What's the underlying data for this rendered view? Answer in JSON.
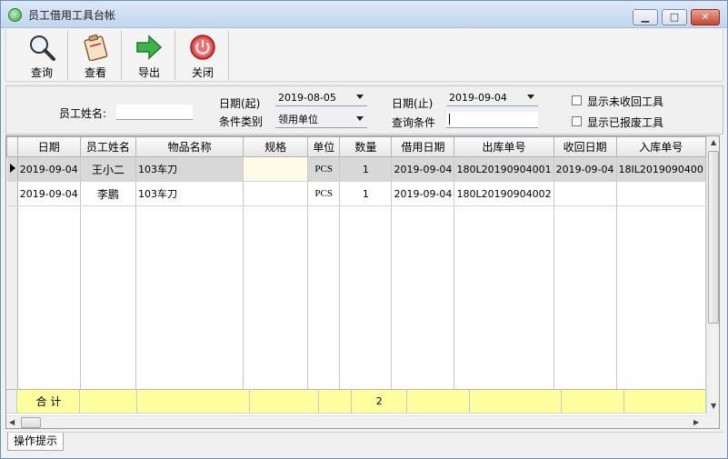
{
  "window": {
    "title": "员工借用工具台帐"
  },
  "toolbar": {
    "query": "查询",
    "view": "查看",
    "export": "导出",
    "close": "关闭"
  },
  "filter": {
    "employee_label": "员工姓名:",
    "employee_value": "",
    "date_start_label": "日期(起)",
    "date_start_value": "2019-08-05",
    "date_end_label": "日期(止)",
    "date_end_value": "2019-09-04",
    "condition_type_label": "条件类别",
    "condition_type_value": "领用单位",
    "query_condition_label": "查询条件",
    "query_condition_value": "",
    "show_unreturned_label": "显示未收回工具",
    "show_unreturned_checked": false,
    "show_scrapped_label": "显示已报废工具",
    "show_scrapped_checked": false
  },
  "grid": {
    "columns": [
      "日期",
      "员工姓名",
      "物品名称",
      "规格",
      "单位",
      "数量",
      "借用日期",
      "出库单号",
      "收回日期",
      "入库单号"
    ],
    "rows": [
      {
        "date": "2019-09-04",
        "employee": "王小二",
        "item": "103车刀",
        "spec": "",
        "unit": "PCS",
        "qty": "1",
        "borrow_date": "2019-09-04",
        "out_no": "180L20190904001",
        "return_date": "2019-09-04",
        "in_no": "18IL2019090400"
      },
      {
        "date": "2019-09-04",
        "employee": "李鹏",
        "item": "103车刀",
        "spec": "",
        "unit": "PCS",
        "qty": "1",
        "borrow_date": "2019-09-04",
        "out_no": "180L20190904002",
        "return_date": "",
        "in_no": ""
      }
    ],
    "total_label": "合 计",
    "total_qty": "2"
  },
  "status": {
    "tab_label": "操作提示"
  },
  "colors": {
    "total_row": "#ffff9f",
    "title_bar": "#c3d6ef",
    "close_button": "#c8452d"
  }
}
